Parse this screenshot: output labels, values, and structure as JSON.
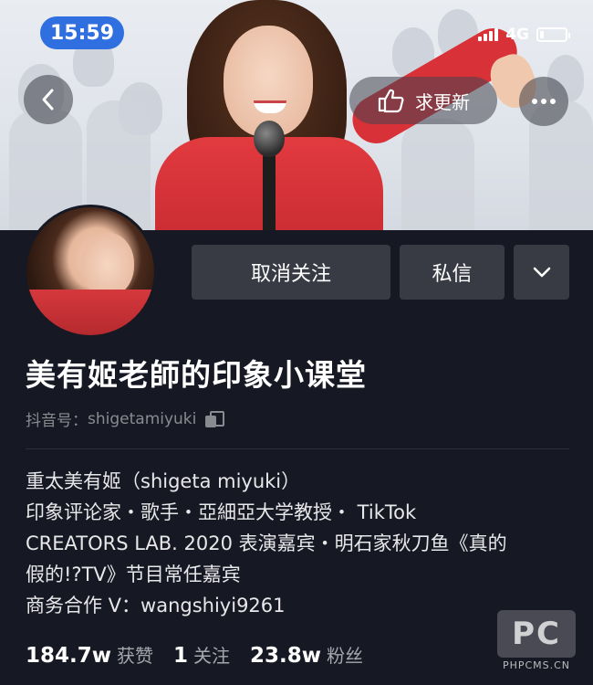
{
  "status_bar": {
    "time": "15:59",
    "network": "4G",
    "battery_level": 0.15
  },
  "header": {
    "request_update_label": "求更新"
  },
  "profile": {
    "nickname": "美有姬老師的印象小课堂",
    "douyin_id_label": "抖音号：",
    "douyin_id": "shigetamiyuki",
    "actions": {
      "unfollow_label": "取消关注",
      "message_label": "私信"
    },
    "bio_lines": [
      "重太美有姬（shigeta miyuki）",
      "印象评论家・歌手・亞細亞大学教授・ TikTok",
      "CREATORS LAB. 2020 表演嘉宾・明石家秋刀鱼《真的",
      "假的!?TV》节目常任嘉宾",
      "商务合作 V：wangshiyi9261"
    ],
    "stats": [
      {
        "value": "184.7w",
        "label": "获赞"
      },
      {
        "value": "1",
        "label": "关注"
      },
      {
        "value": "23.8w",
        "label": "粉丝"
      }
    ]
  },
  "watermark": {
    "logo_text": "PC",
    "site_text": "PHPCMS.CN"
  },
  "icons": {
    "back": "chevron-left-icon",
    "request": "pointing-hand-icon",
    "more": "more-dots-icon",
    "dropdown": "chevron-down-icon",
    "copy": "copy-icon"
  },
  "colors": {
    "background": "#161823",
    "button": "#393b44",
    "time_pill": "#2f6fe0",
    "secondary_text": "#8a8b91"
  }
}
